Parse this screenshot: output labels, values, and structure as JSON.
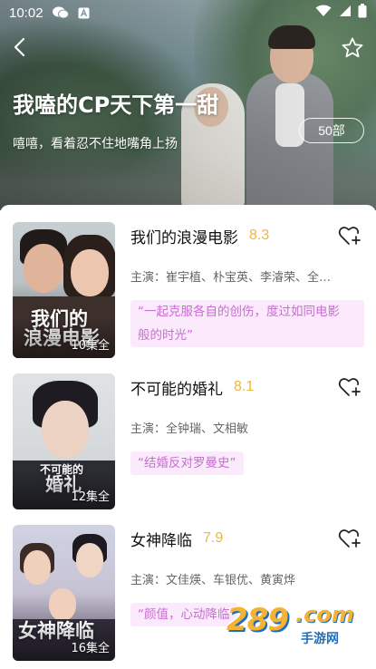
{
  "status_bar": {
    "time": "10:02"
  },
  "header": {
    "title": "我嗑的CP天下第一甜",
    "subtitle": "嘻嘻，看着忍不住地嘴角上扬",
    "count_label": "50部"
  },
  "items": [
    {
      "title": "我们的浪漫电影",
      "rating": "8.3",
      "cast": "主演：崔宇植、朴宝英、李濬荣、全…",
      "quote": "“一起克服各自的创伤，度过如同电影",
      "quote_line2": "般的时光”",
      "episodes": "10集全",
      "poster_text": "我们的\n浪漫电影"
    },
    {
      "title": "不可能的婚礼",
      "rating": "8.1",
      "cast": "主演：全钟瑞、文相敏",
      "quote": "“结婚反对罗曼史”",
      "episodes": "12集全",
      "poster_text": "不可能的\n婚礼"
    },
    {
      "title": "女神降临",
      "rating": "7.9",
      "cast": "主演：文佳煐、车银优、黄寅烨",
      "quote": "“颜值，心动降临",
      "episodes": "16集全",
      "poster_text": "女神降临"
    }
  ],
  "watermark": {
    "number": "289",
    "domain": ".com",
    "sub": "手游网"
  },
  "colors": {
    "rating": "#f2b33d",
    "quote_text": "#c66fcf",
    "quote_bg": "#fbeafb"
  }
}
